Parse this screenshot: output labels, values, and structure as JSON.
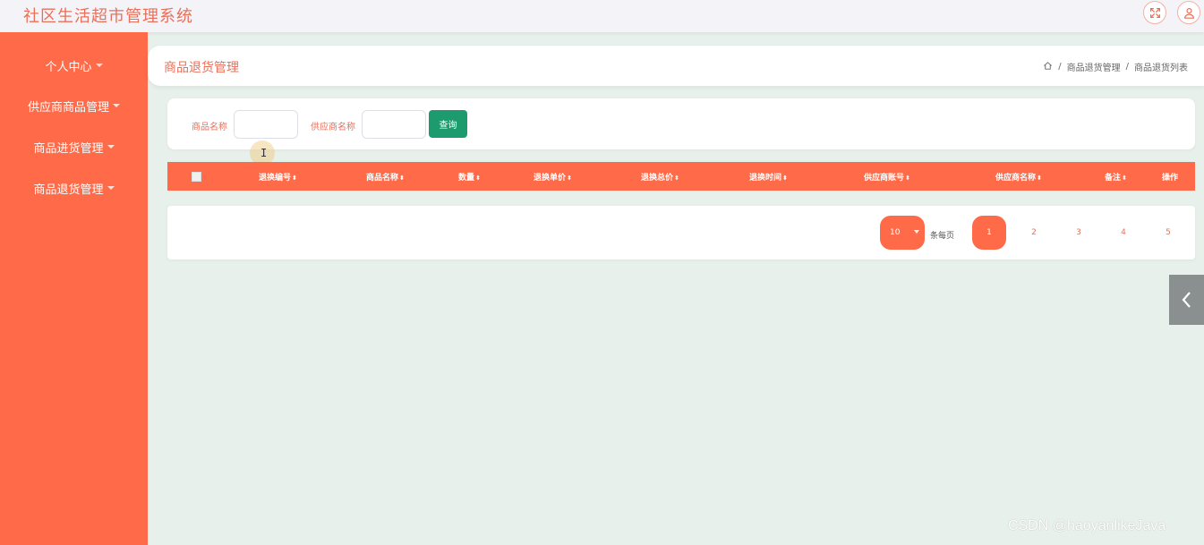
{
  "app": {
    "title": "社区生活超市管理系统"
  },
  "topbar": {
    "fullscreen_icon": "fullscreen-icon",
    "user_icon": "user-icon"
  },
  "sidebar": {
    "items": [
      {
        "label": "个人中心"
      },
      {
        "label": "供应商商品管理"
      },
      {
        "label": "商品进货管理"
      },
      {
        "label": "商品退货管理"
      }
    ]
  },
  "header": {
    "page_title": "商品退货管理",
    "breadcrumb": [
      "商品退货管理",
      "商品退货列表"
    ],
    "separator": "/"
  },
  "search": {
    "fields": [
      {
        "label": "商品名称",
        "value": ""
      },
      {
        "label": "供应商名称",
        "value": ""
      }
    ],
    "button_label": "查询"
  },
  "table": {
    "columns": [
      "退换编号",
      "商品名称",
      "数量",
      "退换单价",
      "退换总价",
      "退换时间",
      "供应商账号",
      "供应商名称",
      "备注",
      "操作"
    ],
    "rows": []
  },
  "pagination": {
    "page_size": "10",
    "per_page_label": "条每页",
    "pages": [
      "1",
      "2",
      "3",
      "4",
      "5"
    ],
    "current_page": "1"
  },
  "cursor": {
    "glyph": "I"
  },
  "watermark": {
    "text": "CSDN @haoyanlikeJava"
  },
  "colors": {
    "accent": "#ff6a48",
    "title_text": "#e8705a",
    "search_button": "#1e9b6e",
    "background": "#e8f0ec"
  }
}
